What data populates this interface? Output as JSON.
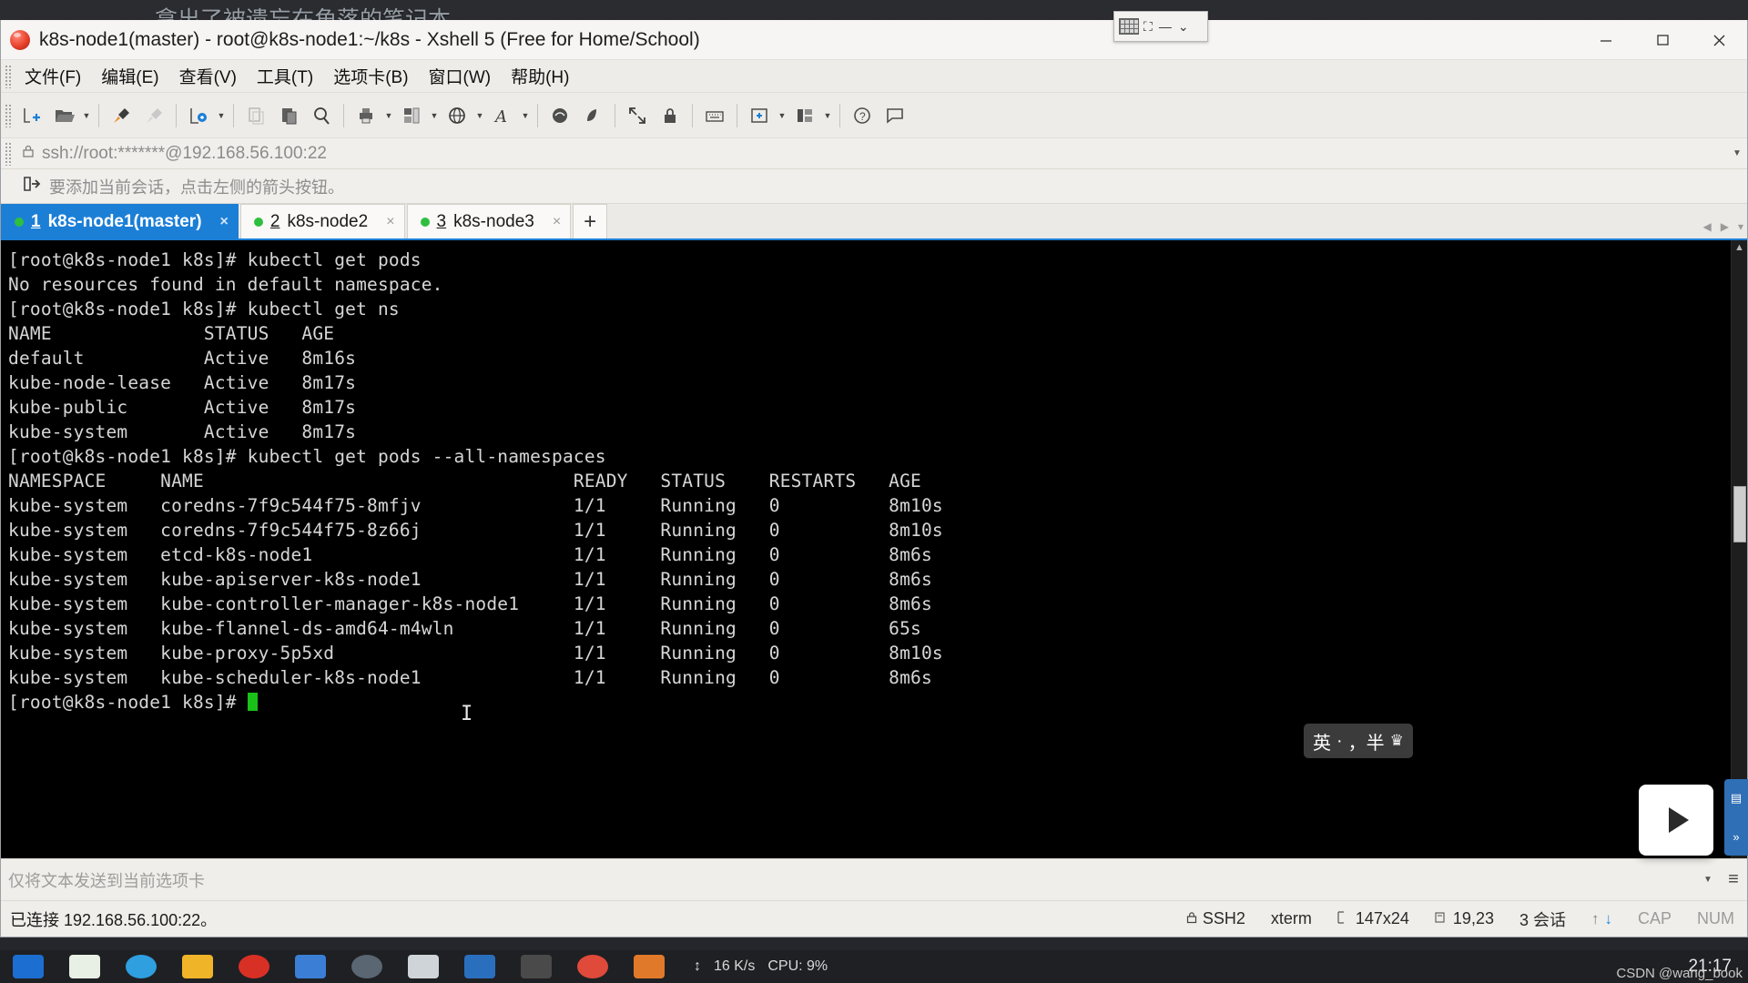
{
  "desktop": {
    "watermark": "拿出了被遗忘在角落的笔记本"
  },
  "window": {
    "title": "k8s-node1(master) - root@k8s-node1:~/k8s - Xshell 5 (Free for Home/School)",
    "logo_icon": "xshell-logo-icon",
    "controls": [
      {
        "name": "minimize-button",
        "glyph": "—"
      },
      {
        "name": "maximize-button",
        "glyph": "▢"
      },
      {
        "name": "close-button",
        "glyph": "✕"
      }
    ],
    "mini_float": {
      "grid_icon": "keyboard-grid-icon",
      "restore_icon": "restore-icon",
      "minimize_icon": "minimize-icon",
      "chevron_icon": "chevron-down-icon"
    }
  },
  "menubar": [
    {
      "label": "文件(F)",
      "name": "menu-file"
    },
    {
      "label": "编辑(E)",
      "name": "menu-edit"
    },
    {
      "label": "查看(V)",
      "name": "menu-view"
    },
    {
      "label": "工具(T)",
      "name": "menu-tools"
    },
    {
      "label": "选项卡(B)",
      "name": "menu-tabs"
    },
    {
      "label": "窗口(W)",
      "name": "menu-window"
    },
    {
      "label": "帮助(H)",
      "name": "menu-help"
    }
  ],
  "toolbar": {
    "buttons": [
      {
        "name": "new-session-button",
        "icon": "new-file-icon",
        "caret": false
      },
      {
        "name": "open-session-button",
        "icon": "folder-open-icon",
        "caret": true
      },
      {
        "sep": true
      },
      {
        "name": "connect-button",
        "icon": "plug-connect-icon",
        "caret": false
      },
      {
        "name": "disconnect-button",
        "icon": "plug-disconnect-icon",
        "caret": false
      },
      {
        "sep": true
      },
      {
        "name": "session-properties-button",
        "icon": "gear-window-icon",
        "caret": true
      },
      {
        "sep": true
      },
      {
        "name": "copy-button",
        "icon": "copy-icon",
        "caret": false
      },
      {
        "name": "paste-button",
        "icon": "paste-icon",
        "caret": false
      },
      {
        "name": "find-button",
        "icon": "search-icon",
        "caret": false
      },
      {
        "sep": true
      },
      {
        "name": "print-button",
        "icon": "printer-icon",
        "caret": true
      },
      {
        "name": "layout-button",
        "icon": "layout-icon",
        "caret": true
      },
      {
        "name": "web-transfer-button",
        "icon": "globe-icon",
        "caret": true
      },
      {
        "name": "font-button",
        "icon": "font-A-icon",
        "caret": true
      },
      {
        "sep": true
      },
      {
        "name": "xftp-button",
        "icon": "xftp-icon",
        "caret": false
      },
      {
        "name": "xagent-button",
        "icon": "xagent-icon",
        "caret": false
      },
      {
        "sep": true
      },
      {
        "name": "fullscreen-button",
        "icon": "fullscreen-icon",
        "caret": false
      },
      {
        "name": "lock-button",
        "icon": "lock-icon",
        "caret": false
      },
      {
        "sep": true
      },
      {
        "name": "keyboard-button",
        "icon": "keyboard-icon",
        "caret": false
      },
      {
        "sep": true
      },
      {
        "name": "add-tab-button",
        "icon": "add-box-icon",
        "caret": true
      },
      {
        "name": "split-view-button",
        "icon": "split-view-icon",
        "caret": true
      },
      {
        "sep": true
      },
      {
        "name": "help-button",
        "icon": "help-circle-icon",
        "caret": false
      },
      {
        "name": "feedback-button",
        "icon": "comment-icon",
        "caret": false
      }
    ]
  },
  "address_bar": {
    "lock_icon": "lock-icon",
    "value": "ssh://root:*******@192.168.56.100:22",
    "dropdown_icon": "chevron-down-icon"
  },
  "hint_bar": {
    "icon": "add-session-arrow-icon",
    "text": "要添加当前会话，点击左侧的箭头按钮。"
  },
  "tabs": {
    "items": [
      {
        "num": "1",
        "label": "k8s-node1(master)",
        "active": true,
        "status_color": "#2fbf3f",
        "name": "tab-k8s-node1"
      },
      {
        "num": "2",
        "label": "k8s-node2",
        "active": false,
        "status_color": "#2fbf3f",
        "name": "tab-k8s-node2"
      },
      {
        "num": "3",
        "label": "k8s-node3",
        "active": false,
        "status_color": "#2fbf3f",
        "name": "tab-k8s-node3"
      }
    ],
    "add_label": "+",
    "nav_prev": "◀",
    "nav_next": "▶",
    "nav_menu": "▾"
  },
  "terminal": {
    "prompt": "[root@k8s-node1 k8s]#",
    "lines": [
      "[root@k8s-node1 k8s]# kubectl get pods",
      "No resources found in default namespace.",
      "[root@k8s-node1 k8s]# kubectl get ns",
      "NAME              STATUS   AGE",
      "default           Active   8m16s",
      "kube-node-lease   Active   8m17s",
      "kube-public       Active   8m17s",
      "kube-system       Active   8m17s",
      "[root@k8s-node1 k8s]# kubectl get pods --all-namespaces",
      "NAMESPACE     NAME                                  READY   STATUS    RESTARTS   AGE",
      "kube-system   coredns-7f9c544f75-8mfjv              1/1     Running   0          8m10s",
      "kube-system   coredns-7f9c544f75-8z66j              1/1     Running   0          8m10s",
      "kube-system   etcd-k8s-node1                        1/1     Running   0          8m6s",
      "kube-system   kube-apiserver-k8s-node1              1/1     Running   0          8m6s",
      "kube-system   kube-controller-manager-k8s-node1     1/1     Running   0          8m6s",
      "kube-system   kube-flannel-ds-amd64-m4wln           1/1     Running   0          65s",
      "kube-system   kube-proxy-5p5xd                      1/1     Running   0          8m10s",
      "kube-system   kube-scheduler-k8s-node1              1/1     Running   0          8m6s"
    ],
    "last_prompt": "[root@k8s-node1 k8s]# ",
    "ibeam_glyph": "I",
    "namespaces_table": {
      "headers": [
        "NAME",
        "STATUS",
        "AGE"
      ],
      "rows": [
        [
          "default",
          "Active",
          "8m16s"
        ],
        [
          "kube-node-lease",
          "Active",
          "8m17s"
        ],
        [
          "kube-public",
          "Active",
          "8m17s"
        ],
        [
          "kube-system",
          "Active",
          "8m17s"
        ]
      ]
    },
    "pods_table": {
      "headers": [
        "NAMESPACE",
        "NAME",
        "READY",
        "STATUS",
        "RESTARTS",
        "AGE"
      ],
      "rows": [
        [
          "kube-system",
          "coredns-7f9c544f75-8mfjv",
          "1/1",
          "Running",
          "0",
          "8m10s"
        ],
        [
          "kube-system",
          "coredns-7f9c544f75-8z66j",
          "1/1",
          "Running",
          "0",
          "8m10s"
        ],
        [
          "kube-system",
          "etcd-k8s-node1",
          "1/1",
          "Running",
          "0",
          "8m6s"
        ],
        [
          "kube-system",
          "kube-apiserver-k8s-node1",
          "1/1",
          "Running",
          "0",
          "8m6s"
        ],
        [
          "kube-system",
          "kube-controller-manager-k8s-node1",
          "1/1",
          "Running",
          "0",
          "8m6s"
        ],
        [
          "kube-system",
          "kube-flannel-ds-amd64-m4wln",
          "1/1",
          "Running",
          "0",
          "65s"
        ],
        [
          "kube-system",
          "kube-proxy-5p5xd",
          "1/1",
          "Running",
          "0",
          "8m10s"
        ],
        [
          "kube-system",
          "kube-scheduler-k8s-node1",
          "1/1",
          "Running",
          "0",
          "8m6s"
        ]
      ]
    }
  },
  "ime": {
    "mode": "英",
    "dot": "·",
    "width": "，半",
    "gem_icon": "gem-icon"
  },
  "overlays": {
    "video_icon": "play-video-icon",
    "side_tool_icon": "sidebar-tool-icon"
  },
  "send_bar": {
    "placeholder": "仅将文本发送到当前选项卡",
    "dropdown_icon": "chevron-down-icon",
    "menu_icon": "hamburger-menu-icon"
  },
  "status_bar": {
    "connection": "已连接 192.168.56.100:22。",
    "protocol_icon": "lock-icon",
    "protocol": "SSH2",
    "term_type": "xterm",
    "size_icon": "resize-icon",
    "size": "147x24",
    "cursor_icon": "cursor-pos-icon",
    "cursor": "19,23",
    "sessions": "3 会话",
    "upload_icon": "arrow-up-icon",
    "download_icon": "arrow-down-icon",
    "caps": "CAP",
    "num": "NUM"
  },
  "taskbar": {
    "network": "16 K/s",
    "network_icon": "network-speed-icon",
    "cpu": "CPU: 9%",
    "clock": "21:17",
    "csdn": "CSDN @wang_book"
  },
  "colors": {
    "accent": "#1c7fd6",
    "terminal_bg": "#000000",
    "terminal_fg": "#d6d6d6",
    "status_green": "#2fbf3f",
    "cursor_green": "#19c119"
  }
}
